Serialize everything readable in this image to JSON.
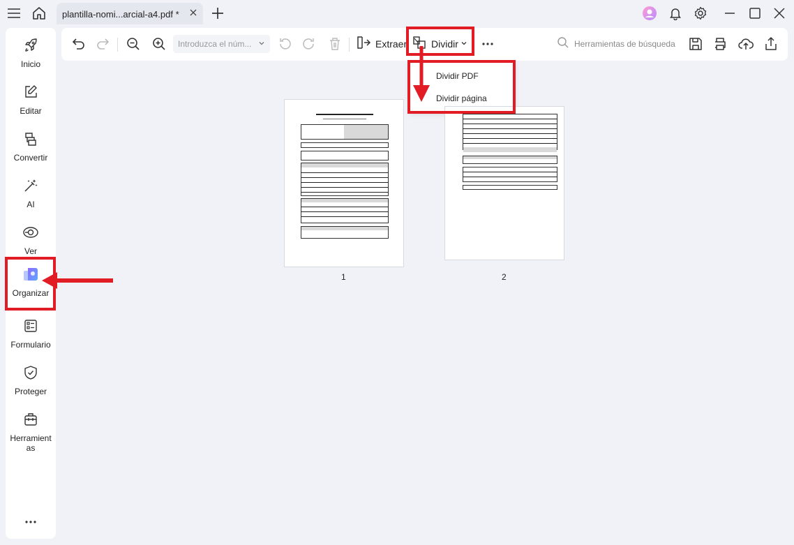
{
  "titlebar": {
    "tab_title": "plantilla-nomi...arcial-a4.pdf *"
  },
  "sidebar": {
    "items": [
      {
        "label": "Inicio",
        "icon": "rocket-icon"
      },
      {
        "label": "Editar",
        "icon": "edit-icon"
      },
      {
        "label": "Convertir",
        "icon": "convert-icon"
      },
      {
        "label": "AI",
        "icon": "ai-magic-icon"
      },
      {
        "label": "Ver",
        "icon": "eye-icon"
      },
      {
        "label": "Organizar",
        "icon": "organize-icon"
      },
      {
        "label": "Formulario",
        "icon": "form-icon"
      },
      {
        "label": "Proteger",
        "icon": "shield-icon"
      },
      {
        "label": "Herramientas",
        "icon": "toolbox-icon"
      }
    ],
    "tools_label_line1": "Herramient",
    "tools_label_line2": "as"
  },
  "toolbar": {
    "page_input_placeholder": "Introduzca el núm...",
    "extract_label": "Extraer",
    "split_label": "Dividir",
    "search_label": "Herramientas de búsqueda"
  },
  "dropdown": {
    "items": [
      "Dividir PDF",
      "Dividir página"
    ]
  },
  "pages": [
    {
      "number": "1"
    },
    {
      "number": "2"
    }
  ],
  "colors": {
    "highlight": "#e21c24",
    "organize_gradient_start": "#8a6cff",
    "organize_gradient_end": "#5fa8ff"
  }
}
